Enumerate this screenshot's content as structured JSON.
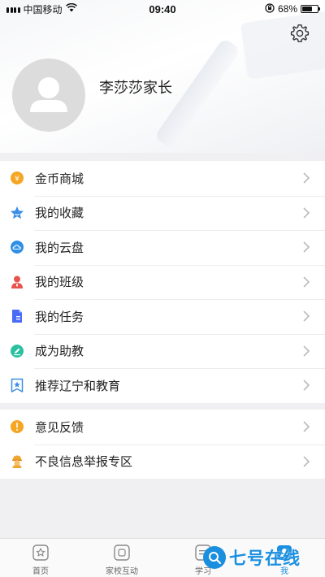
{
  "status_bar": {
    "carrier": "中国移动",
    "time": "09:40",
    "battery_percent": "68%",
    "battery_level": 0.68
  },
  "profile": {
    "name": "李莎莎家长"
  },
  "menu_group_1": [
    {
      "label": "金币商城",
      "icon": "coin-icon",
      "color": "#f5a623"
    },
    {
      "label": "我的收藏",
      "icon": "star-icon",
      "color": "#3a8ee6"
    },
    {
      "label": "我的云盘",
      "icon": "cloud-icon",
      "color": "#2f8fe6"
    },
    {
      "label": "我的班级",
      "icon": "class-icon",
      "color": "#e8534e"
    },
    {
      "label": "我的任务",
      "icon": "task-icon",
      "color": "#4a6cf7"
    },
    {
      "label": "成为助教",
      "icon": "pencil-icon",
      "color": "#2bc1a0"
    },
    {
      "label": "推荐辽宁和教育",
      "icon": "recommend-icon",
      "color": "#3a8ee6"
    }
  ],
  "menu_group_2": [
    {
      "label": "意见反馈",
      "icon": "feedback-icon",
      "color": "#f5a623"
    },
    {
      "label": "不良信息举报专区",
      "icon": "report-icon",
      "color": "#f0a630"
    }
  ],
  "tab_bar": [
    {
      "label": "首页",
      "icon": "home-icon"
    },
    {
      "label": "家校互动",
      "icon": "interaction-icon"
    },
    {
      "label": "学习",
      "icon": "study-icon"
    },
    {
      "label": "我",
      "icon": "me-icon",
      "active": true
    }
  ],
  "watermark": {
    "text": "七号在线"
  },
  "colors": {
    "accent": "#1a8fe0",
    "background": "#f0f0f2",
    "avatar_bg": "#dcdcdc"
  }
}
